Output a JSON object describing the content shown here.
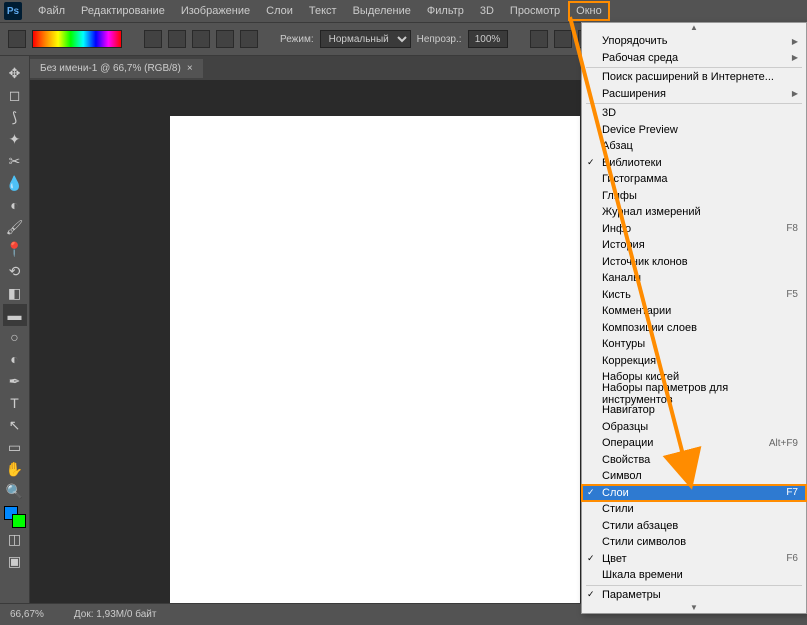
{
  "app": {
    "logo": "Ps"
  },
  "menubar": {
    "items": [
      "Файл",
      "Редактирование",
      "Изображение",
      "Слои",
      "Текст",
      "Выделение",
      "Фильтр",
      "3D",
      "Просмотр",
      "Окно"
    ],
    "highlighted": "Окно"
  },
  "options": {
    "mode_label": "Режим:",
    "mode_value": "Нормальный",
    "opacity_label": "Непрозр.:",
    "opacity_value": "100%"
  },
  "doc": {
    "tab_title": "Без имени-1 @ 66,7% (RGB/8)",
    "close": "×"
  },
  "status": {
    "zoom": "66,67%",
    "docinfo": "Док: 1,93M/0 байт"
  },
  "dropdown": {
    "sections": [
      [
        {
          "label": "Упорядочить",
          "sub": true
        },
        {
          "label": "Рабочая среда",
          "sub": true
        }
      ],
      [
        {
          "label": "Поиск расширений в Интернете..."
        },
        {
          "label": "Расширения",
          "sub": true
        }
      ],
      [
        {
          "label": "3D"
        },
        {
          "label": "Device Preview"
        },
        {
          "label": "Абзац"
        },
        {
          "label": "Библиотеки",
          "checked": true
        },
        {
          "label": "Гистограмма"
        },
        {
          "label": "Глифы"
        },
        {
          "label": "Журнал измерений"
        },
        {
          "label": "Инфо",
          "shortcut": "F8"
        },
        {
          "label": "История"
        },
        {
          "label": "Источник клонов"
        },
        {
          "label": "Каналы"
        },
        {
          "label": "Кисть",
          "shortcut": "F5"
        },
        {
          "label": "Комментарии"
        },
        {
          "label": "Композиции слоев"
        },
        {
          "label": "Контуры"
        },
        {
          "label": "Коррекция"
        },
        {
          "label": "Наборы кистей"
        },
        {
          "label": "Наборы параметров для инструментов"
        },
        {
          "label": "Навигатор"
        },
        {
          "label": "Образцы"
        },
        {
          "label": "Операции",
          "shortcut": "Alt+F9"
        },
        {
          "label": "Свойства"
        },
        {
          "label": "Символ"
        },
        {
          "label": "Слои",
          "shortcut": "F7",
          "checked": true,
          "selected": true,
          "highlight": true
        },
        {
          "label": "Стили"
        },
        {
          "label": "Стили абзацев"
        },
        {
          "label": "Стили символов"
        },
        {
          "label": "Цвет",
          "shortcut": "F6",
          "checked": true
        },
        {
          "label": "Шкала времени"
        }
      ],
      [
        {
          "label": "Параметры",
          "checked": true
        }
      ]
    ]
  },
  "tools": {
    "list": [
      "move",
      "marquee",
      "lasso",
      "wand",
      "crop",
      "eyedropper",
      "spot",
      "brush",
      "stamp",
      "history",
      "eraser",
      "gradient",
      "blur",
      "dodge",
      "pen",
      "type",
      "arrow",
      "shape",
      "hand",
      "zoom"
    ]
  }
}
